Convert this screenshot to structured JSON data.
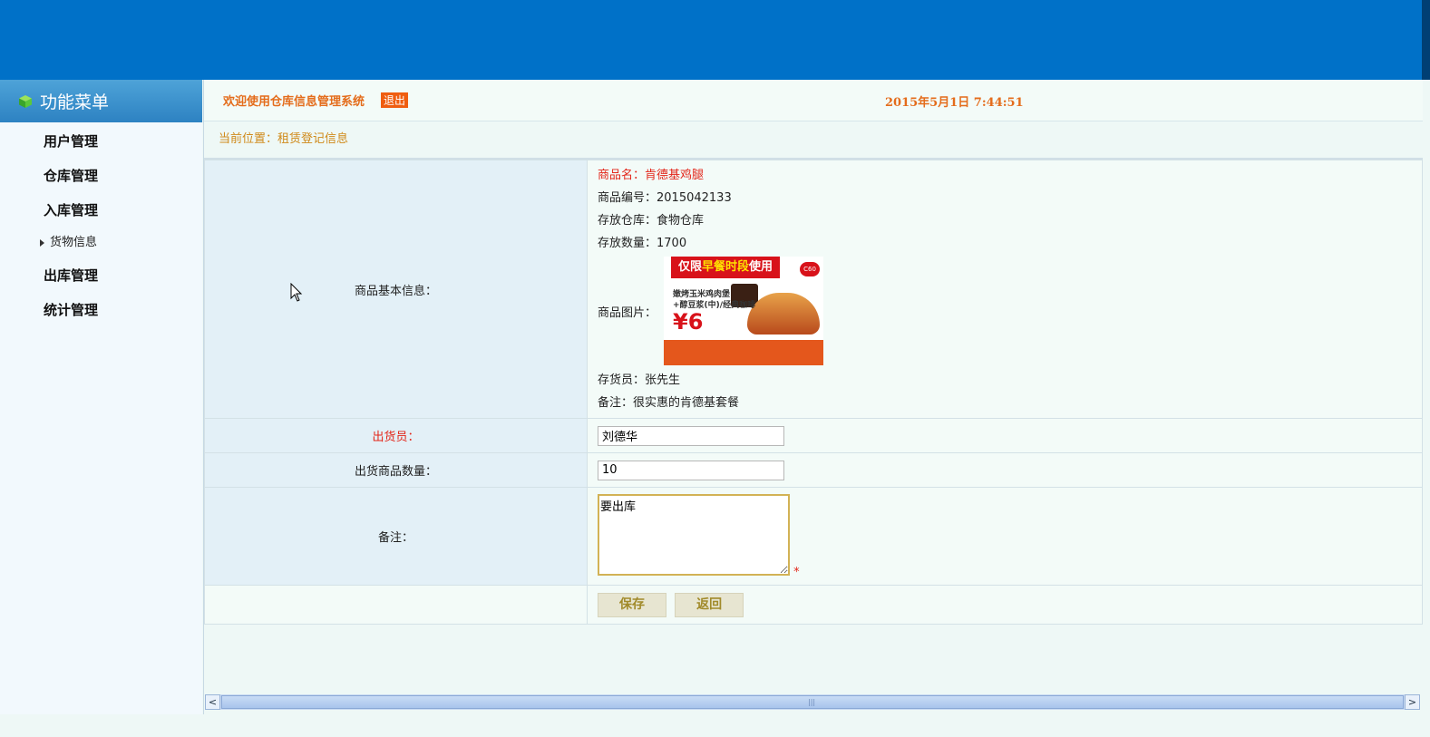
{
  "sidebar": {
    "header": "功能菜单",
    "items": [
      {
        "label": "用户管理"
      },
      {
        "label": "仓库管理"
      },
      {
        "label": "入库管理"
      },
      {
        "label": "货物信息"
      },
      {
        "label": "出库管理"
      },
      {
        "label": "统计管理"
      }
    ]
  },
  "header": {
    "welcome": "欢迎使用仓库信息管理系统",
    "logout": "退出",
    "datetime": "2015年5月1日 7:44:51"
  },
  "breadcrumb": "当前位置：租赁登记信息",
  "product": {
    "label": "商品基本信息：",
    "name": "商品名：肯德基鸡腿",
    "code": "商品编号：2015042133",
    "warehouse": "存放仓库：食物仓库",
    "quantity": "存放数量：1700",
    "image_label": "商品图片：",
    "keeper": "存货员：张先生",
    "note": "备注：很实惠的肯德基套餐",
    "image": {
      "ribbon_a": "仅限",
      "ribbon_b": "早餐时段",
      "ribbon_c": "使用",
      "line1": "嫩烤玉米鸡肉堡",
      "line2": "+醇豆浆(中)/经典咖啡",
      "price": "¥6",
      "badge": "C60"
    }
  },
  "form": {
    "shipper_label": "出货员：",
    "shipper_value": "刘德华",
    "count_label": "出货商品数量：",
    "count_value": "10",
    "remark_label": "备注：",
    "remark_value": "要出库",
    "required_mark": "*",
    "save": "保存",
    "back": "返回"
  },
  "scrollbar": {
    "left_arrow": "<",
    "right_arrow": ">",
    "grip": "|||"
  },
  "colors": {
    "topbar": "#0071c8",
    "accent_orange": "#e46c1b",
    "required_red": "#e3261a"
  }
}
